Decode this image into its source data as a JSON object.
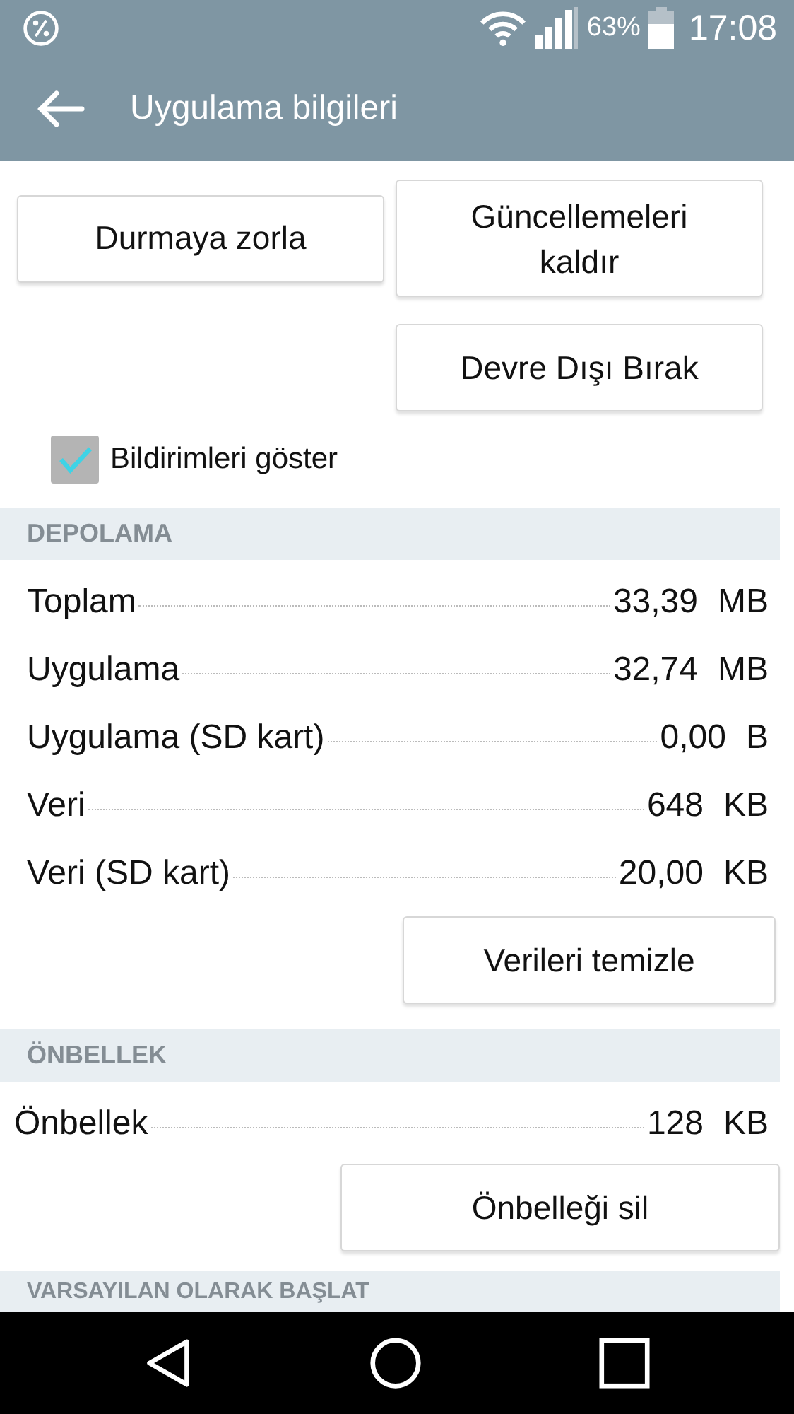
{
  "status_bar": {
    "battery": "63%",
    "time": "17:08"
  },
  "app_bar": {
    "title": "Uygulama bilgileri"
  },
  "action_buttons": [
    {
      "label": "Durmaya zorla"
    },
    {
      "label": "Güncellemeleri kaldır"
    },
    {
      "label": "Devre Dışı Bırak"
    }
  ],
  "notifications_checkbox": {
    "label": "Bildirimleri göster",
    "checked": true
  },
  "storage": {
    "header": "DEPOLAMA",
    "rows": [
      {
        "label": "Toplam",
        "value": "33,39",
        "unit": "MB"
      },
      {
        "label": "Uygulama",
        "value": "32,74",
        "unit": "MB"
      },
      {
        "label": "Uygulama (SD kart)",
        "value": "0,00",
        "unit": "B"
      },
      {
        "label": "Veri",
        "value": "648",
        "unit": "KB"
      },
      {
        "label": "Veri (SD kart)",
        "value": "20,00",
        "unit": "KB"
      }
    ],
    "button": "Verileri temizle"
  },
  "cache": {
    "header": "ÖNBELLEK",
    "rows": [
      {
        "label": "Önbellek",
        "value": "128",
        "unit": "KB"
      }
    ],
    "button": "Önbelleği sil"
  },
  "launch_default": {
    "header": "VARSAYILAN OLARAK BAŞLAT"
  }
}
